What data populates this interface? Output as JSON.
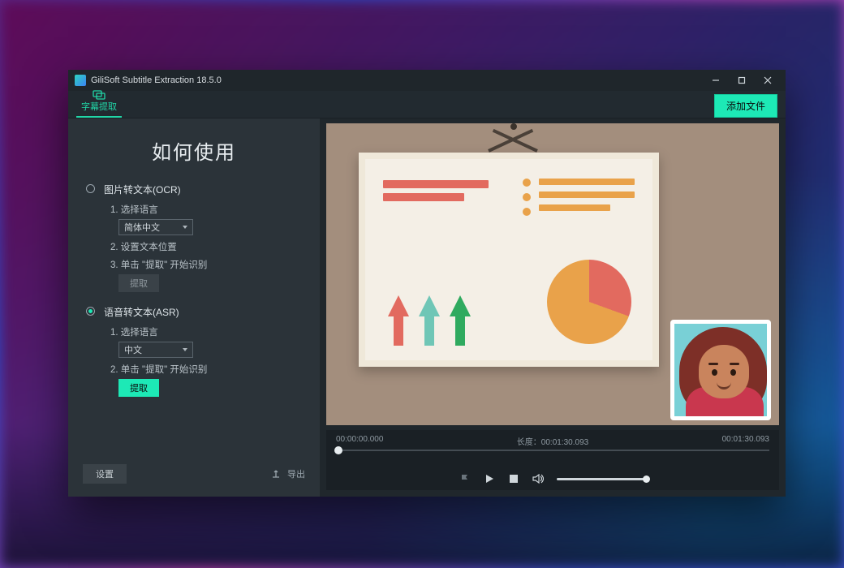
{
  "app": {
    "title": "GiliSoft Subtitle Extraction 18.5.0"
  },
  "toolbar": {
    "tab_label": "字幕提取",
    "add_file": "添加文件"
  },
  "howto": {
    "title": "如何使用",
    "ocr": {
      "head": "图片转文本(OCR)",
      "step1": "1. 选择语言",
      "lang_value": "简体中文",
      "step2": "2. 设置文本位置",
      "step3": "3. 单击 \"提取\" 开始识别",
      "extract_btn": "提取"
    },
    "asr": {
      "head": "语音转文本(ASR)",
      "step1": "1. 选择语言",
      "lang_value": "中文",
      "step2": "2. 单击 \"提取\" 开始识别",
      "extract_btn": "提取"
    }
  },
  "footer": {
    "settings": "设置",
    "export": "导出"
  },
  "timeline": {
    "start": "00:00:00.000",
    "length_label": "长度：",
    "length_value": "00:01:30.093",
    "end": "00:01:30.093"
  }
}
